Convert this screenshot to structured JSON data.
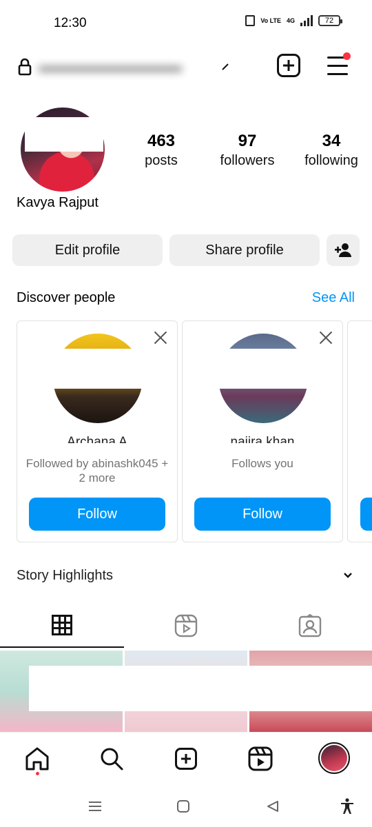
{
  "status_bar": {
    "time": "12:30",
    "network_label": "Vo LTE",
    "network_type": "4G",
    "battery": "72"
  },
  "profile": {
    "display_name": "Kavya Rajput",
    "stats": [
      {
        "value": "463",
        "label": "posts"
      },
      {
        "value": "97",
        "label": "followers"
      },
      {
        "value": "34",
        "label": "following"
      }
    ]
  },
  "actions": {
    "edit_profile": "Edit profile",
    "share_profile": "Share profile"
  },
  "discover": {
    "title": "Discover people",
    "see_all": "See All",
    "cards": [
      {
        "name": "Archana A",
        "subtitle": "Followed by abinashk045 + 2 more",
        "follow_label": "Follow"
      },
      {
        "name": "najira khan",
        "subtitle": "Follows you",
        "follow_label": "Follow"
      }
    ]
  },
  "highlights": {
    "title": "Story Highlights"
  },
  "colors": {
    "accent": "#0095f6",
    "notification": "#ff3040",
    "button_gray": "#efefef"
  },
  "icons": {
    "top_bar": [
      "lock-icon",
      "chevron-down-icon",
      "new-post-icon",
      "menu-icon"
    ],
    "tabs": [
      "grid-icon",
      "reels-icon",
      "tagged-icon"
    ],
    "bottom_nav": [
      "home-icon",
      "search-icon",
      "create-icon",
      "reels-icon",
      "profile-avatar"
    ],
    "system_nav": [
      "recents-icon",
      "home-icon",
      "back-icon",
      "accessibility-icon"
    ]
  }
}
